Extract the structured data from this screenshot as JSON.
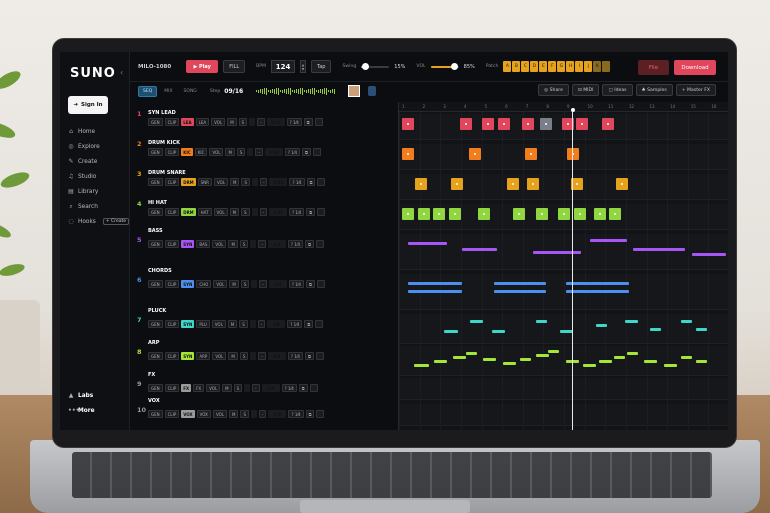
{
  "app": {
    "logo": "SUNO",
    "title": "MILO-1080",
    "collapse": "‹"
  },
  "sidebar": {
    "signin": "Sign In",
    "items": [
      {
        "label": "Home",
        "icon": "home-icon",
        "glyph": "⌂"
      },
      {
        "label": "Explore",
        "icon": "compass-icon",
        "glyph": "◎"
      },
      {
        "label": "Create",
        "icon": "create-icon",
        "glyph": "✎"
      },
      {
        "label": "Studio",
        "icon": "studio-icon",
        "glyph": "♫"
      },
      {
        "label": "Library",
        "icon": "library-icon",
        "glyph": "▤"
      },
      {
        "label": "Search",
        "icon": "search-icon",
        "glyph": "⌕"
      },
      {
        "label": "Hooks",
        "icon": "hooks-icon",
        "glyph": "◌"
      }
    ],
    "create_badge": "+ Create",
    "labs": "Labs",
    "more": "More"
  },
  "transport": {
    "play": "▶ Play",
    "fill": "FILL",
    "bpm_label": "BPM",
    "bpm": "124",
    "tap": "Tap",
    "swing_label": "Swing",
    "swing": "15%",
    "swing_value": 0.15,
    "vol_label": "VOL",
    "vol": "85%",
    "vol_value": 0.85,
    "patch_label": "Patch",
    "patch": [
      "A",
      "B",
      "C",
      "D",
      "E",
      "F",
      "G",
      "H",
      "I",
      "J",
      "K"
    ],
    "file": "File",
    "download": "Download"
  },
  "subbar": {
    "tabs": [
      "SEQ",
      "MIX",
      "SONG"
    ],
    "step_label": "Step",
    "step": "09/16",
    "tools": [
      "◎ Share",
      "⊡ MIDI",
      "▢ Ideas",
      "♣ Samples",
      "+ Master FX"
    ]
  },
  "colors": {
    "red": "#e0465c",
    "orange": "#f27d1d",
    "gold": "#e6a21c",
    "green": "#8fd63f",
    "purple": "#a855f7",
    "blue": "#4c8ff0",
    "teal": "#3dd6c8",
    "lime": "#a3e635"
  },
  "tracks": [
    {
      "num": "1",
      "name": "SYN LEAD",
      "tag": "LEA",
      "color": "#e0465c",
      "div": "1/16"
    },
    {
      "num": "2",
      "name": "DRUM KICK",
      "tag": "KIC",
      "color": "#f27d1d",
      "div": "1/16"
    },
    {
      "num": "3",
      "name": "DRUM SNARE",
      "tag": "SNR",
      "color": "#e6a21c",
      "div": "1/32",
      "tag2": "DRM"
    },
    {
      "num": "4",
      "name": "HI HAT",
      "tag": "HAT",
      "color": "#8fd63f",
      "div": "1/32",
      "tag2": "DRM"
    },
    {
      "num": "5",
      "name": "BASS",
      "tag": "BAS",
      "color": "#a855f7",
      "div": "1/4",
      "tag2": "SYN"
    },
    {
      "num": "6",
      "name": "CHORDS",
      "tag": "CHO",
      "color": "#4c8ff0",
      "div": "1/4",
      "tag2": "SYN"
    },
    {
      "num": "7",
      "name": "PLUCK",
      "tag": "PLU",
      "color": "#3dd6c8",
      "div": "1/8",
      "tag2": "SYN"
    },
    {
      "num": "8",
      "name": "ARP",
      "tag": "ARP",
      "color": "#a3e635",
      "div": "1/8",
      "tag2": "SYN"
    },
    {
      "num": "9",
      "name": "FX",
      "tag": "FX",
      "color": "#9a9a9a",
      "div": "1/4",
      "tag2": "FX"
    },
    {
      "num": "10",
      "name": "VOX",
      "tag": "VOX",
      "color": "#9a9a9a",
      "div": "1/4",
      "tag2": "VOX"
    }
  ],
  "ctl": {
    "gen": "GEN",
    "clip": "CLIP",
    "vol": "VOL",
    "m": "M",
    "s": "S",
    "misc": "? 1⁄4"
  },
  "ruler": [
    "1",
    "2",
    "3",
    "4",
    "5",
    "6",
    "7",
    "8",
    "9",
    "10",
    "11",
    "12",
    "13",
    "14",
    "15",
    "16"
  ]
}
